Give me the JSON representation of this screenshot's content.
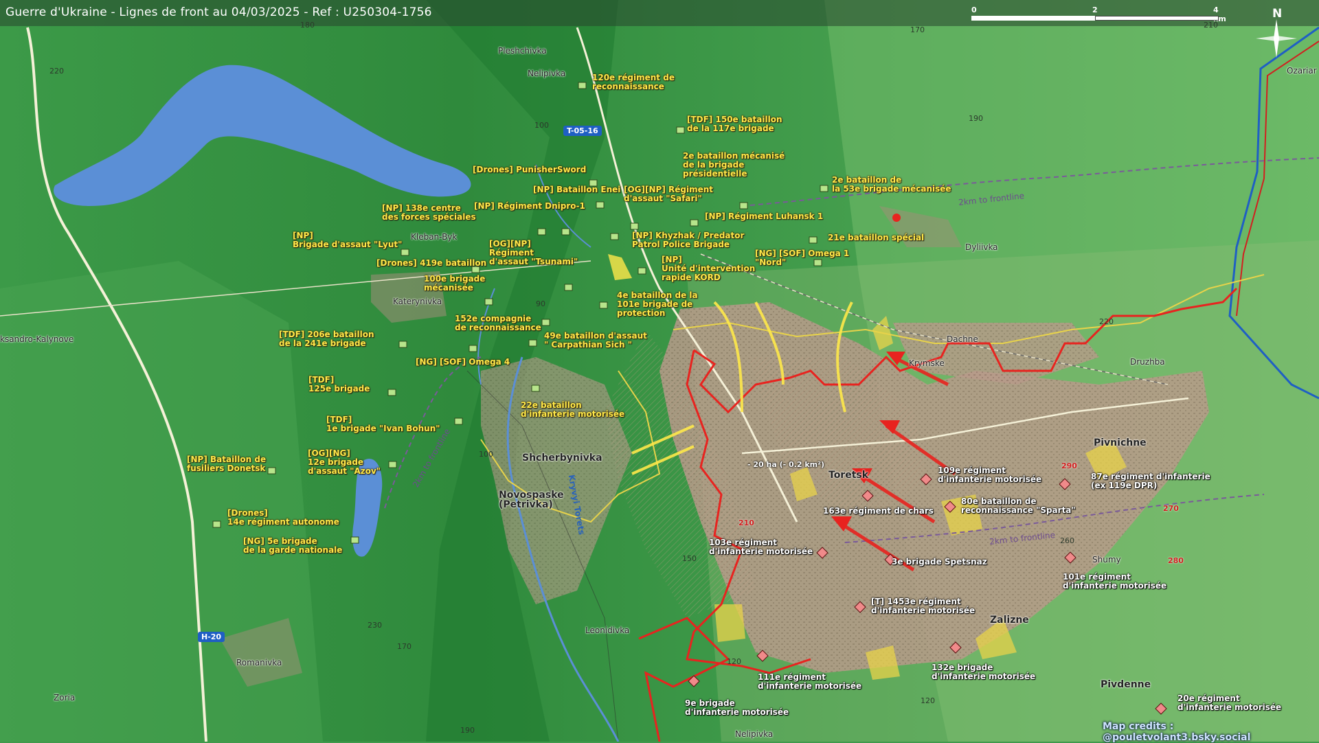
{
  "title": "Guerre d'Ukraine - Lignes de front au 04/03/2025 - Ref : U250304-1756",
  "scale": {
    "t0": "0",
    "t1": "2",
    "t2": "4 km"
  },
  "north": "N",
  "credits": "Map credits : @pouletvolant3.bsky.social",
  "area_note": "- 20 ha (- 0.2 km²)",
  "colors": {
    "ukr": "#ffe94a",
    "rus": "#e8231f",
    "frontline_ref": "#7a5a9a",
    "water": "#5b8fd6"
  },
  "roads": [
    {
      "label": "T-05-16",
      "color": "#1f5fc4"
    },
    {
      "label": "H-20",
      "color": "#1f5fc4"
    }
  ],
  "frontline_refs": [
    "2km to frontline",
    "2km to frontline",
    "2km to frontline"
  ],
  "river": "Kryvyi Torets",
  "towns": [
    {
      "name": "Pleshchivka",
      "big": false
    },
    {
      "name": "Nelipivka",
      "big": false
    },
    {
      "name": "Kleban-Byk",
      "big": false
    },
    {
      "name": "Katerynivka",
      "big": false
    },
    {
      "name": "ksandro-Kalynove",
      "big": false
    },
    {
      "name": "Dyliivka",
      "big": false
    },
    {
      "name": "Dachne",
      "big": false
    },
    {
      "name": "Krymske",
      "big": false
    },
    {
      "name": "Druzhba",
      "big": false
    },
    {
      "name": "Pivnichne",
      "big": true
    },
    {
      "name": "Toretsk",
      "big": true
    },
    {
      "name": "Shcherbynivka",
      "big": true
    },
    {
      "name": "Novospaske\n(Petrivka)",
      "big": true
    },
    {
      "name": "Leonidivka",
      "big": false
    },
    {
      "name": "Zalizne",
      "big": true
    },
    {
      "name": "Pivdenne",
      "big": true
    },
    {
      "name": "Shumy",
      "big": false
    },
    {
      "name": "Romanivka",
      "big": false
    },
    {
      "name": "Zoria",
      "big": false
    },
    {
      "name": "Nelipivka",
      "big": false
    },
    {
      "name": "Ozariar",
      "big": false
    }
  ],
  "elevations": [
    "180",
    "170",
    "220",
    "100",
    "190",
    "220",
    "210",
    "90",
    "100",
    "150",
    "120",
    "170",
    "190",
    "260",
    "120",
    "230"
  ],
  "elevations_red": [
    "210",
    "290",
    "270",
    "280"
  ],
  "ukr_units": [
    "120e régiment de\nreconnaissance",
    "[TDF] 150e bataillon\nde la 117e brigade",
    "[Drones] PunisherSword",
    "2e bataillon mécanisé\nde la brigade\nprésidentielle",
    "2e bataillon de\nla 53e brigade mécanisée",
    "[NP] Bataillon Enei",
    "[OG][NP] Régiment\nd'assaut \"Safari\"",
    "[NP] Régiment Dnipro-1",
    "[NP] 138e centre\ndes forces spéciales",
    "[NP] Régiment Luhansk 1",
    "[NP] Khyzhak / Predator\nPatrol Police Brigade",
    "21e bataillon spécial",
    "[NP]\nBrigade d'assaut \"Lyut\"",
    "[OG][NP]\nRégiment\nd'assaut \"Tsunami\"",
    "[NG] [SOF] Omega 1\n\"Nord\"",
    "[Drones] 419e bataillon",
    "[NP]\nUnité d'intervention\nrapide KORD",
    "100e brigade\nmécanisée",
    "4e bataillon de la\n101e brigade de\nprotection",
    "152e compagnie\nde reconnaissance",
    "[TDF] 206e bataillon\nde la 241e brigade",
    "49e bataillon d'assaut\n\" Carpathian Sich \"",
    "[NG] [SOF] Omega 4",
    "[TDF]\n125e brigade",
    "22e bataillon\nd'infanterie motorisée",
    "[TDF]\n1e brigade \"Ivan Bohun\"",
    "[NP] Bataillon de\nfusiliers Donetsk",
    "[OG][NG]\n12e brigade\nd'assaut \"Azov\"",
    "[Drones]\n14e régiment autonome",
    "[NG] 5e brigade\nde la garde nationale"
  ],
  "rus_units": [
    "109e régiment\nd'infanterie motorisée",
    "87e régiment d'infanterie\n(ex 119e DPR)",
    "80e bataillon de\nreconnaissance \"Sparta\"",
    "163e régiment de chars",
    "103e régiment\nd'infanterie motorisée",
    "3e brigade Spetsnaz",
    "101e régiment\nd'infanterie motorisée",
    "[T] 1453e régiment\nd'infanterie motorisée",
    "132e brigade\nd'infanterie motorisée",
    "111e régiment\nd'infanterie motorisée",
    "9e brigade\nd'infanterie motorisée",
    "20e régiment\nd'infanterie motorisée"
  ]
}
